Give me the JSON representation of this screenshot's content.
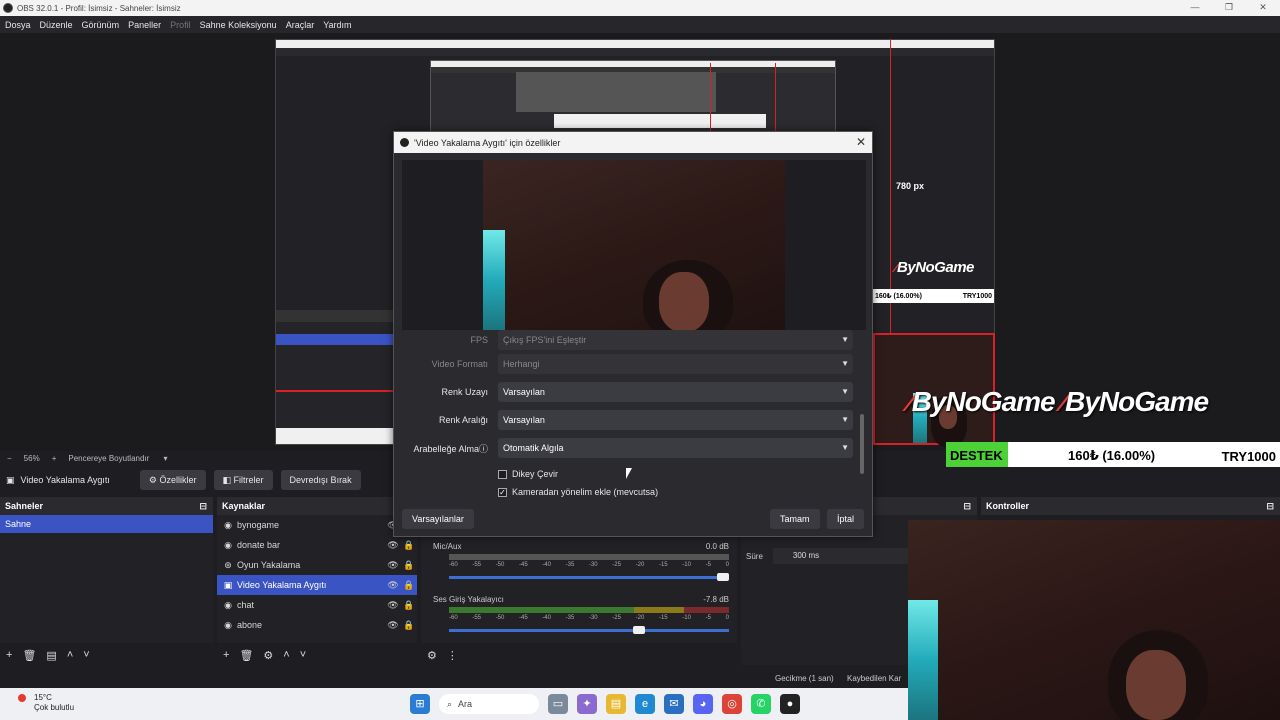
{
  "window": {
    "title": "OBS 32.0.1 - Profil: İsimsiz - Sahneler: İsimsiz"
  },
  "menu": {
    "items": [
      "Dosya",
      "Düzenle",
      "Görünüm",
      "Paneller",
      "Profil",
      "Sahne Koleksiyonu",
      "Araçlar",
      "Yardım"
    ]
  },
  "preview": {
    "measure_label": "780 px",
    "overlay_small": {
      "logo": "ByNoGame",
      "pct": "160₺ (16.00%)",
      "try": "TRY1000"
    },
    "overlay_big": {
      "logo1": "ByNoGame",
      "logo2": "ByNoGame",
      "destek": "DESTEK",
      "pct": "160₺ (16.00%)",
      "try": "TRY1000"
    }
  },
  "zoombar": {
    "zoom": "56%",
    "mode": "Pencereye Boyutlandır"
  },
  "source_toolbar": {
    "source_name": "Video Yakalama Aygıtı",
    "properties": "Özellikler",
    "filters": "Filtreler",
    "deactivate": "Devredışı Bırak"
  },
  "scenes": {
    "title": "Sahneler",
    "items": [
      "Sahne"
    ]
  },
  "sources": {
    "title": "Kaynaklar",
    "items": [
      {
        "label": "bynogame",
        "icon": "browser-icon"
      },
      {
        "label": "donate bar",
        "icon": "browser-icon"
      },
      {
        "label": "Oyun Yakalama",
        "icon": "gamepad-icon"
      },
      {
        "label": "Video Yakalama Aygıtı",
        "icon": "camera-icon",
        "selected": true
      },
      {
        "label": "chat",
        "icon": "browser-icon"
      },
      {
        "label": "abone",
        "icon": "browser-icon"
      }
    ]
  },
  "mixer": {
    "channels": [
      {
        "name": "Mic/Aux",
        "db": "0.0 dB",
        "volume": 1.0
      },
      {
        "name": "Ses Giriş Yakalayıcı",
        "db": "-7.8 dB",
        "volume": 0.7
      }
    ],
    "ticks": [
      "-60",
      "-55",
      "-50",
      "-45",
      "-40",
      "-35",
      "-30",
      "-25",
      "-20",
      "-15",
      "-10",
      "-5",
      "0"
    ]
  },
  "transitions": {
    "duration_label": "Süre",
    "duration_value": "300 ms"
  },
  "controls": {
    "title": "Kontroller"
  },
  "statusbar": {
    "delay": "Gecikme (1 san)",
    "dropped": "Kaybedilen Kar"
  },
  "dialog": {
    "title": "'Video Yakalama Aygıtı' için özellikler",
    "fields": [
      {
        "label": "FPS",
        "value": "Çıkış FPS'ini Eşleştir",
        "disabled": true
      },
      {
        "label": "Video Formatı",
        "value": "Herhangi",
        "disabled": true
      },
      {
        "label": "Renk Uzayı",
        "value": "Varsayılan"
      },
      {
        "label": "Renk Aralığı",
        "value": "Varsayılan"
      },
      {
        "label": "Arabelleğe Alma",
        "value": "Otomatik Algıla"
      }
    ],
    "checkboxes": [
      {
        "label": "Dikey Çevir",
        "checked": false
      },
      {
        "label": "Kameradan yönelim ekle (mevcutsa)",
        "checked": true
      }
    ],
    "defaults_button": "Varsayılanlar",
    "ok_button": "Tamam",
    "cancel_button": "İptal"
  },
  "taskbar": {
    "temperature": "15°C",
    "weather": "Çok bulutlu",
    "search": "Ara"
  },
  "colors": {
    "accent": "#3b54c4",
    "panel": "#1e1e22",
    "red": "#d6202a",
    "green": "#4cd137"
  }
}
